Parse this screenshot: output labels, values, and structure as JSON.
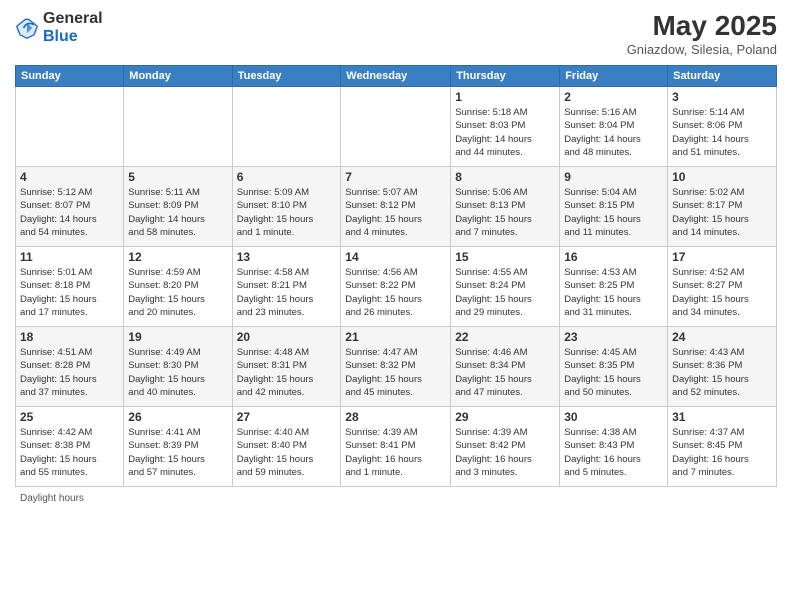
{
  "header": {
    "logo_line1": "General",
    "logo_line2": "Blue",
    "month_title": "May 2025",
    "location": "Gniazdow, Silesia, Poland"
  },
  "footer": {
    "daylight_label": "Daylight hours"
  },
  "weekdays": [
    "Sunday",
    "Monday",
    "Tuesday",
    "Wednesday",
    "Thursday",
    "Friday",
    "Saturday"
  ],
  "weeks": [
    [
      {
        "day": "",
        "info": ""
      },
      {
        "day": "",
        "info": ""
      },
      {
        "day": "",
        "info": ""
      },
      {
        "day": "",
        "info": ""
      },
      {
        "day": "1",
        "info": "Sunrise: 5:18 AM\nSunset: 8:03 PM\nDaylight: 14 hours\nand 44 minutes."
      },
      {
        "day": "2",
        "info": "Sunrise: 5:16 AM\nSunset: 8:04 PM\nDaylight: 14 hours\nand 48 minutes."
      },
      {
        "day": "3",
        "info": "Sunrise: 5:14 AM\nSunset: 8:06 PM\nDaylight: 14 hours\nand 51 minutes."
      }
    ],
    [
      {
        "day": "4",
        "info": "Sunrise: 5:12 AM\nSunset: 8:07 PM\nDaylight: 14 hours\nand 54 minutes."
      },
      {
        "day": "5",
        "info": "Sunrise: 5:11 AM\nSunset: 8:09 PM\nDaylight: 14 hours\nand 58 minutes."
      },
      {
        "day": "6",
        "info": "Sunrise: 5:09 AM\nSunset: 8:10 PM\nDaylight: 15 hours\nand 1 minute."
      },
      {
        "day": "7",
        "info": "Sunrise: 5:07 AM\nSunset: 8:12 PM\nDaylight: 15 hours\nand 4 minutes."
      },
      {
        "day": "8",
        "info": "Sunrise: 5:06 AM\nSunset: 8:13 PM\nDaylight: 15 hours\nand 7 minutes."
      },
      {
        "day": "9",
        "info": "Sunrise: 5:04 AM\nSunset: 8:15 PM\nDaylight: 15 hours\nand 11 minutes."
      },
      {
        "day": "10",
        "info": "Sunrise: 5:02 AM\nSunset: 8:17 PM\nDaylight: 15 hours\nand 14 minutes."
      }
    ],
    [
      {
        "day": "11",
        "info": "Sunrise: 5:01 AM\nSunset: 8:18 PM\nDaylight: 15 hours\nand 17 minutes."
      },
      {
        "day": "12",
        "info": "Sunrise: 4:59 AM\nSunset: 8:20 PM\nDaylight: 15 hours\nand 20 minutes."
      },
      {
        "day": "13",
        "info": "Sunrise: 4:58 AM\nSunset: 8:21 PM\nDaylight: 15 hours\nand 23 minutes."
      },
      {
        "day": "14",
        "info": "Sunrise: 4:56 AM\nSunset: 8:22 PM\nDaylight: 15 hours\nand 26 minutes."
      },
      {
        "day": "15",
        "info": "Sunrise: 4:55 AM\nSunset: 8:24 PM\nDaylight: 15 hours\nand 29 minutes."
      },
      {
        "day": "16",
        "info": "Sunrise: 4:53 AM\nSunset: 8:25 PM\nDaylight: 15 hours\nand 31 minutes."
      },
      {
        "day": "17",
        "info": "Sunrise: 4:52 AM\nSunset: 8:27 PM\nDaylight: 15 hours\nand 34 minutes."
      }
    ],
    [
      {
        "day": "18",
        "info": "Sunrise: 4:51 AM\nSunset: 8:28 PM\nDaylight: 15 hours\nand 37 minutes."
      },
      {
        "day": "19",
        "info": "Sunrise: 4:49 AM\nSunset: 8:30 PM\nDaylight: 15 hours\nand 40 minutes."
      },
      {
        "day": "20",
        "info": "Sunrise: 4:48 AM\nSunset: 8:31 PM\nDaylight: 15 hours\nand 42 minutes."
      },
      {
        "day": "21",
        "info": "Sunrise: 4:47 AM\nSunset: 8:32 PM\nDaylight: 15 hours\nand 45 minutes."
      },
      {
        "day": "22",
        "info": "Sunrise: 4:46 AM\nSunset: 8:34 PM\nDaylight: 15 hours\nand 47 minutes."
      },
      {
        "day": "23",
        "info": "Sunrise: 4:45 AM\nSunset: 8:35 PM\nDaylight: 15 hours\nand 50 minutes."
      },
      {
        "day": "24",
        "info": "Sunrise: 4:43 AM\nSunset: 8:36 PM\nDaylight: 15 hours\nand 52 minutes."
      }
    ],
    [
      {
        "day": "25",
        "info": "Sunrise: 4:42 AM\nSunset: 8:38 PM\nDaylight: 15 hours\nand 55 minutes."
      },
      {
        "day": "26",
        "info": "Sunrise: 4:41 AM\nSunset: 8:39 PM\nDaylight: 15 hours\nand 57 minutes."
      },
      {
        "day": "27",
        "info": "Sunrise: 4:40 AM\nSunset: 8:40 PM\nDaylight: 15 hours\nand 59 minutes."
      },
      {
        "day": "28",
        "info": "Sunrise: 4:39 AM\nSunset: 8:41 PM\nDaylight: 16 hours\nand 1 minute."
      },
      {
        "day": "29",
        "info": "Sunrise: 4:39 AM\nSunset: 8:42 PM\nDaylight: 16 hours\nand 3 minutes."
      },
      {
        "day": "30",
        "info": "Sunrise: 4:38 AM\nSunset: 8:43 PM\nDaylight: 16 hours\nand 5 minutes."
      },
      {
        "day": "31",
        "info": "Sunrise: 4:37 AM\nSunset: 8:45 PM\nDaylight: 16 hours\nand 7 minutes."
      }
    ]
  ]
}
